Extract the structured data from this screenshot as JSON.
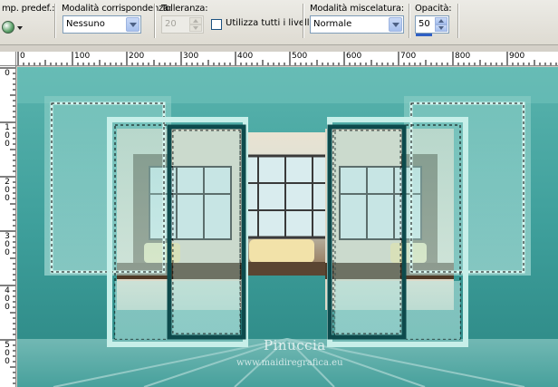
{
  "toolbar": {
    "preset": {
      "label": "mp. predef.:",
      "icon": "preset-sphere-icon"
    },
    "match_mode": {
      "label": "Modalità corrispondenza:",
      "value": "Nessuno"
    },
    "tolerance": {
      "label": "Tolleranza:",
      "value": "20",
      "enabled": false
    },
    "use_all_layers": {
      "label": "Utilizza tutti i livelli",
      "checked": false
    },
    "blend_mode": {
      "label": "Modalità miscelatura:",
      "value": "Normale"
    },
    "opacity": {
      "label": "Opacità:",
      "value": "50",
      "level_percent": 50
    }
  },
  "ruler_top": {
    "labels": [
      "0",
      "100",
      "200",
      "300",
      "400",
      "500",
      "600",
      "700",
      "800",
      "900"
    ]
  },
  "ruler_left": {
    "labels": [
      [
        "0"
      ],
      [
        "1",
        "0",
        "0"
      ],
      [
        "2",
        "0",
        "0"
      ],
      [
        "3",
        "0",
        "0"
      ],
      [
        "4",
        "0",
        "0"
      ],
      [
        "5",
        "0",
        "0"
      ]
    ]
  },
  "canvas": {
    "watermark_name": "Pinuccia",
    "watermark_url": "www.maidiregrafica.eu",
    "colors": {
      "teal_bg": "#3c9a98",
      "teal_light": "#9fd8d2",
      "teal_dark": "#0d4a4c",
      "frame_edge": "#c7efe9",
      "cream": "#f2e2a9"
    }
  }
}
